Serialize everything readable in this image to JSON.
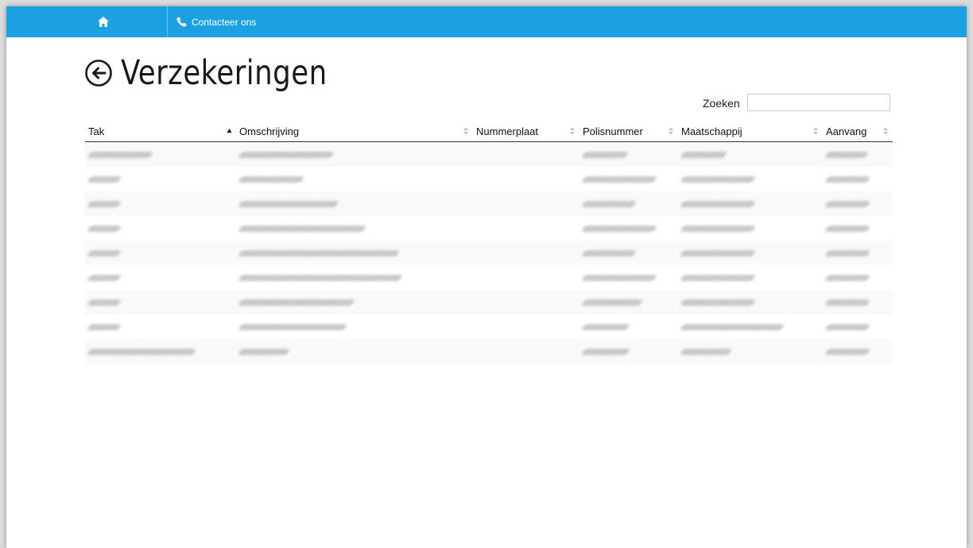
{
  "nav": {
    "contact_label": "Contacteer ons",
    "icons": [
      "home-icon",
      "phone-icon"
    ]
  },
  "page": {
    "title": "Verzekeringen",
    "back_icon": "circle-arrow-left-icon"
  },
  "search": {
    "label": "Zoeken",
    "value": ""
  },
  "table": {
    "columns": [
      {
        "label": "Tak",
        "sort": "ascending"
      },
      {
        "label": "Omschrijving",
        "sort": "none"
      },
      {
        "label": "Nummerplaat",
        "sort": "none"
      },
      {
        "label": "Polisnummer",
        "sort": "none"
      },
      {
        "label": "Maatschappij",
        "sort": "none"
      },
      {
        "label": "Aanvang",
        "sort": "none"
      }
    ],
    "rows_note_redacted": true,
    "row_count": 9
  },
  "colors": {
    "navbar": "#1ba1e2",
    "text": "#1a1a1a"
  }
}
